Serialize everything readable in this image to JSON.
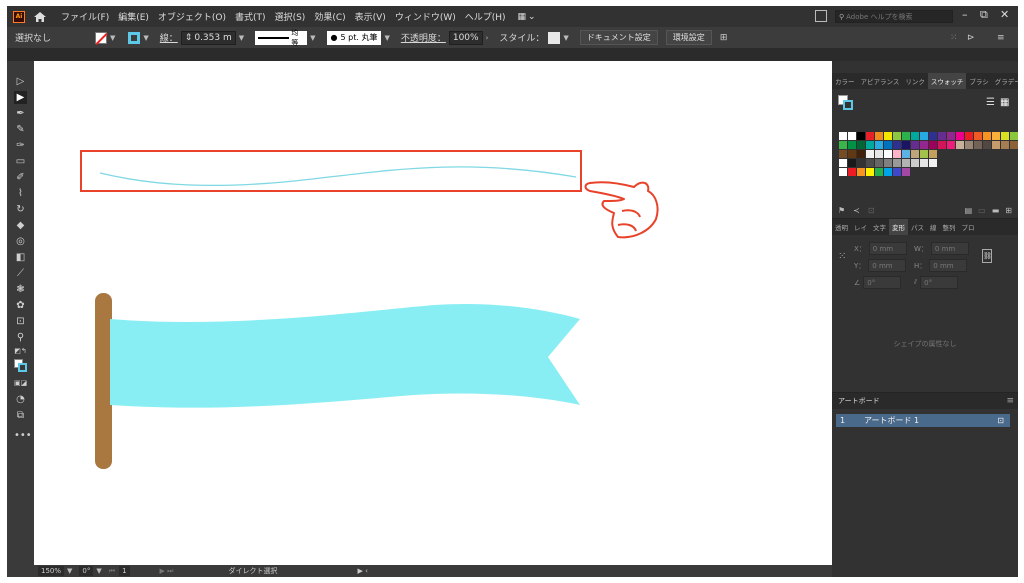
{
  "app": {
    "logo": "Ai"
  },
  "menu": [
    "ファイル(F)",
    "編集(E)",
    "オブジェクト(O)",
    "書式(T)",
    "選択(S)",
    "効果(C)",
    "表示(V)",
    "ウィンドウ(W)",
    "ヘルプ(H)"
  ],
  "search": {
    "placeholder": "Adobe ヘルプを検索"
  },
  "control": {
    "selection": "選択なし",
    "stroke_label": "線：",
    "stroke_width": "0.353 m",
    "profile": "均等",
    "brush": "5 pt. 丸筆",
    "opacity_label": "不透明度：",
    "opacity": "100%",
    "style_label": "スタイル：",
    "doc_settings": "ドキュメント設定",
    "prefs": "環境設定"
  },
  "panels": {
    "top_tabs": [
      "カラー",
      "アピアランス",
      "リンク",
      "スウォッチ",
      "ブラシ",
      "グラデーション"
    ],
    "active_top": "スウォッチ",
    "mid_tabs": [
      "透明",
      "レイ",
      "文字",
      "変形",
      "パス",
      "線",
      "整列",
      "プロ"
    ],
    "active_mid": "変形",
    "transform": {
      "x_label": "X：",
      "x": "0 mm",
      "y_label": "Y：",
      "y": "0 mm",
      "w_label": "W：",
      "w": "0 mm",
      "h_label": "H：",
      "h": "0 mm",
      "angle": "0°",
      "shear": "0°"
    },
    "no_attr": "シェイプの属性なし",
    "artboards_title": "アートボード",
    "artboard_num": "1",
    "artboard_name": "アートボード 1"
  },
  "status": {
    "zoom": "150%",
    "rotate": "0°",
    "page": "1",
    "tool": "ダイレクト選択"
  },
  "colors": {
    "flag": "#88eef3",
    "pole": "#a97740",
    "highlight": "#e8432a",
    "stroke_line": "#7fd8e3"
  }
}
